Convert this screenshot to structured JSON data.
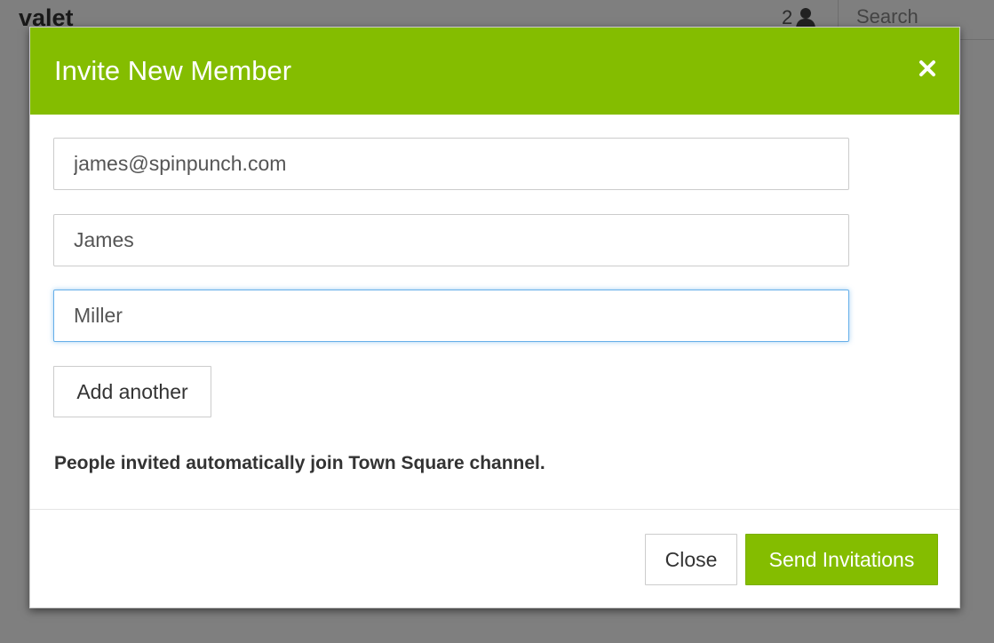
{
  "app": {
    "team_name": "valet",
    "member_count": "2",
    "search": {
      "placeholder": "Search"
    }
  },
  "colors": {
    "accent": "#84bd00",
    "overlay": "rgba(0,0,0,0.5)",
    "focus_border": "#66afe9"
  },
  "icons": {
    "member": "user-icon",
    "close": "close-icon"
  },
  "modal": {
    "title": "Invite New Member",
    "fields": {
      "email": {
        "value": "james@spinpunch.com"
      },
      "first_name": {
        "value": "James"
      },
      "last_name": {
        "value": "Miller",
        "focused": true
      }
    },
    "add_another_label": "Add another",
    "help_text": "People invited automatically join Town Square channel.",
    "footer": {
      "close_label": "Close",
      "send_label": "Send Invitations"
    }
  }
}
